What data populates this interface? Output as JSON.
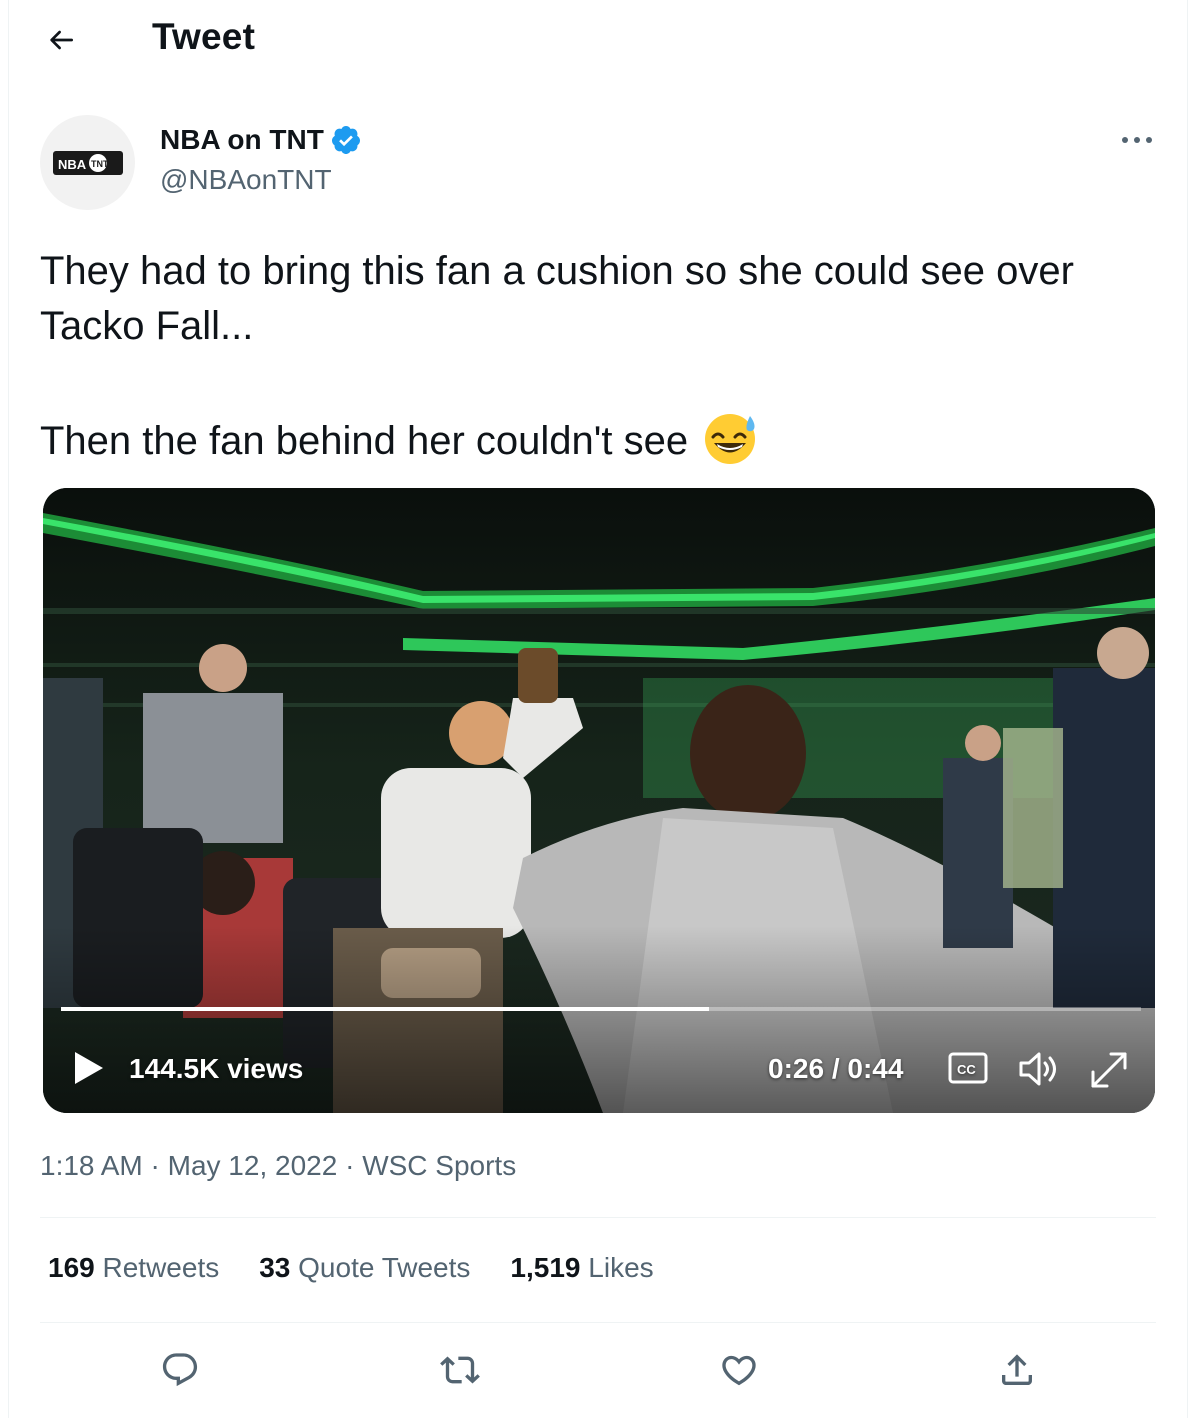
{
  "header": {
    "title": "Tweet"
  },
  "author": {
    "name": "NBA on TNT",
    "handle": "@NBAonTNT",
    "avatar_logo_text": "NBA TNT",
    "verified": true
  },
  "tweet": {
    "line1": "They had to bring this fan a cushion so she could see over Tacko Fall...",
    "line2": "Then the fan behind her couldn't see",
    "emoji": "grinning-face-with-sweat"
  },
  "video": {
    "views": "144.5K views",
    "time": "0:26 / 0:44",
    "progress": 0.6,
    "cc_label": "CC"
  },
  "meta": {
    "time": "1:18 AM",
    "date": "May 12, 2022",
    "source": "WSC Sports",
    "separator": "·"
  },
  "stats": {
    "retweets_count": "169",
    "retweets_label": "Retweets",
    "quotes_count": "33",
    "quotes_label": "Quote Tweets",
    "likes_count": "1,519",
    "likes_label": "Likes"
  },
  "actions": {
    "reply_icon": "reply-icon",
    "retweet_icon": "retweet-icon",
    "like_icon": "like-icon",
    "share_icon": "share-icon"
  },
  "colors": {
    "text_primary": "#0f1419",
    "text_secondary": "#536471",
    "verified_blue": "#1d9bf0",
    "divider": "#eff3f4"
  }
}
